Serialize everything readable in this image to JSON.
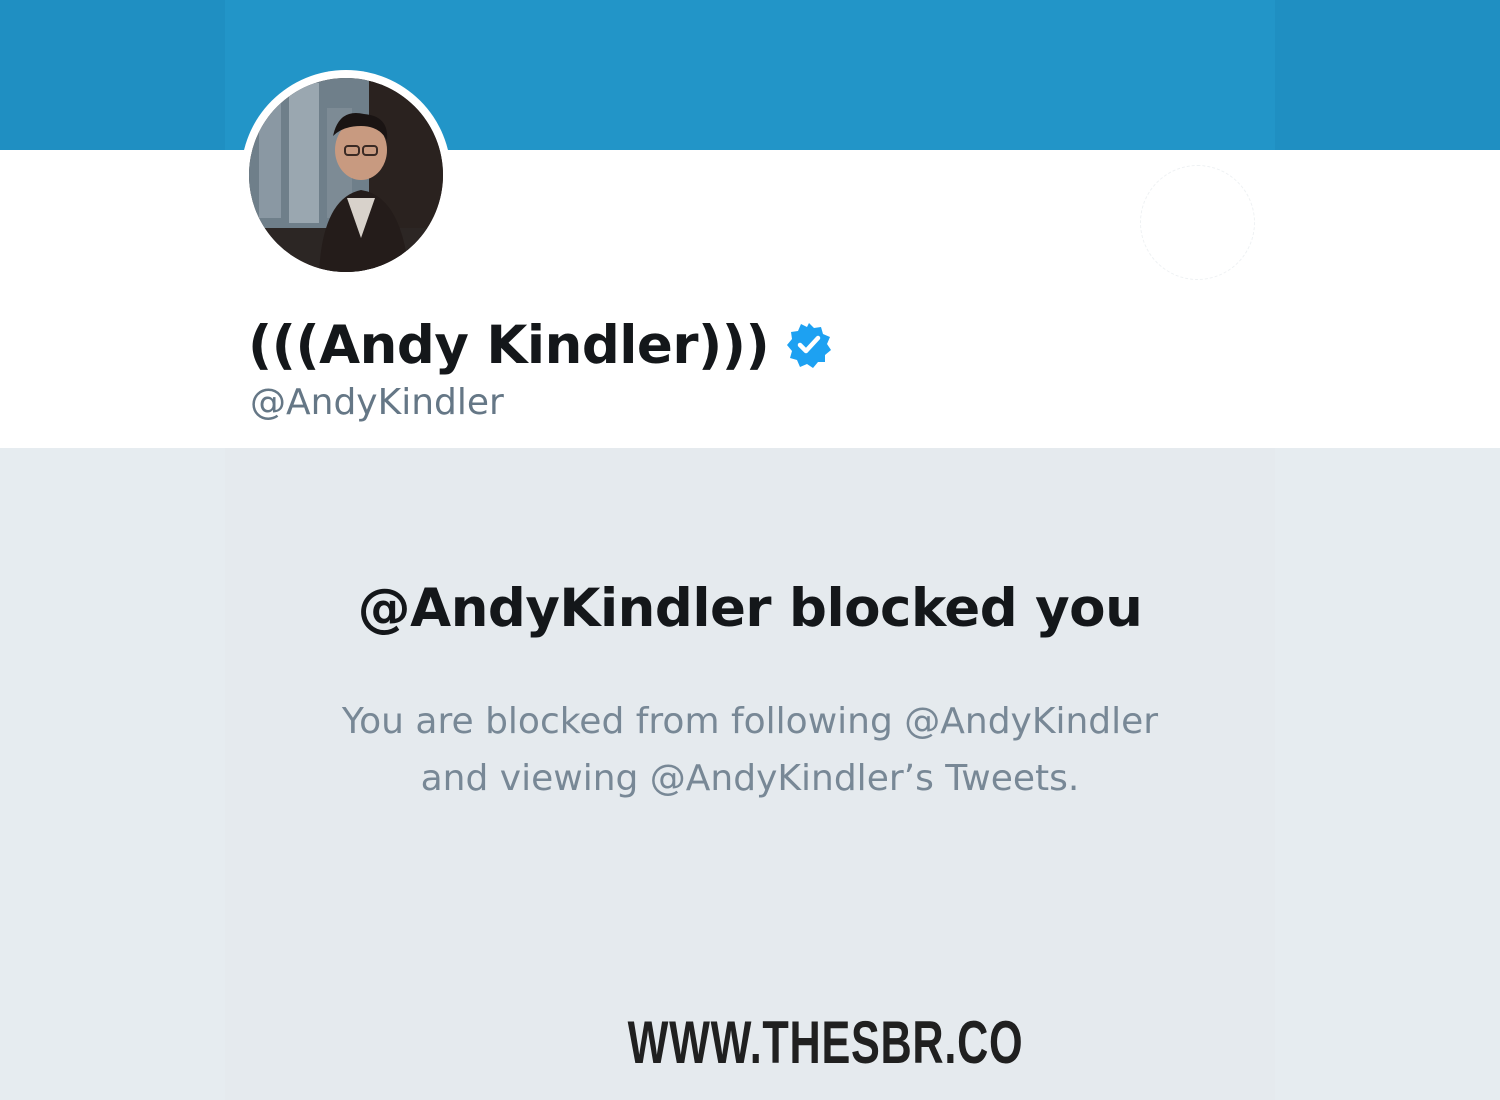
{
  "profile": {
    "display_name": "(((Andy Kindler)))",
    "handle": "@AndyKindler",
    "verified": true,
    "avatar_icon": "profile-photo"
  },
  "blocked": {
    "title": "@AndyKindler blocked you",
    "description_line1": "You are blocked from following @AndyKindler",
    "description_line2": "and viewing @AndyKindler’s Tweets."
  },
  "watermark": {
    "text": "WWW.THESBR.CO"
  },
  "colors": {
    "banner": "#2295c8",
    "verified_badge": "#1da1f2",
    "page_background": "#e6ecf0",
    "name_text": "#14171a",
    "secondary_text": "#657786"
  }
}
